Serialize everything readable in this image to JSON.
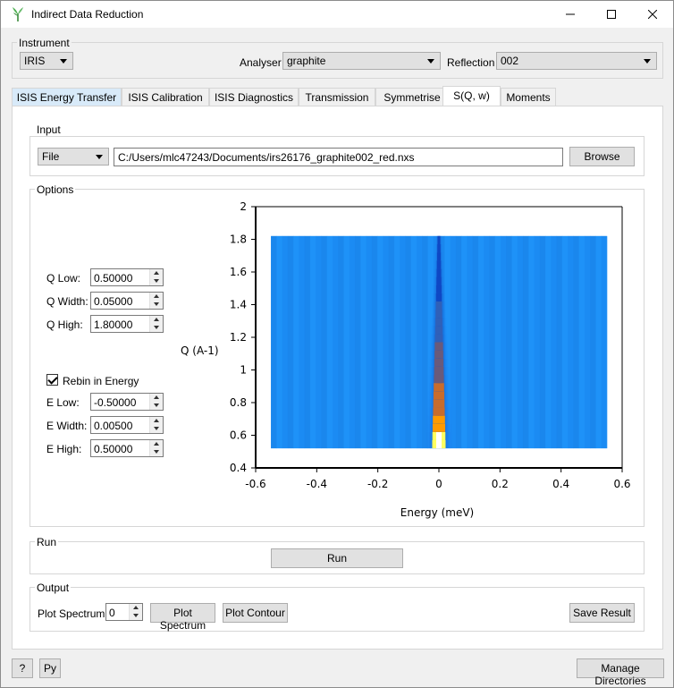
{
  "window": {
    "title": "Indirect Data Reduction",
    "controls": [
      "minimize-icon",
      "maximize-icon",
      "close-icon"
    ]
  },
  "instrument": {
    "group_title": "Instrument",
    "instrument_value": "IRIS",
    "analyser_label": "Analyser",
    "analyser_value": "graphite",
    "reflection_label": "Reflection",
    "reflection_value": "002"
  },
  "tabs": [
    {
      "label": "ISIS Energy Transfer"
    },
    {
      "label": "ISIS Calibration"
    },
    {
      "label": "ISIS Diagnostics"
    },
    {
      "label": "Transmission"
    },
    {
      "label": "Symmetrise"
    },
    {
      "label": "S(Q, w)"
    },
    {
      "label": "Moments"
    }
  ],
  "selected_tab": "S(Q, w)",
  "input": {
    "group_title": "Input",
    "source_type": "File",
    "file_path": "C:/Users/mlc47243/Documents/irs26176_graphite002_red.nxs",
    "browse_label": "Browse"
  },
  "options": {
    "group_title": "Options",
    "q_low_label": "Q Low:",
    "q_low_value": "0.50000",
    "q_width_label": "Q Width:",
    "q_width_value": "0.05000",
    "q_high_label": "Q High:",
    "q_high_value": "1.80000",
    "rebin_label": "Rebin in Energy",
    "rebin_checked": true,
    "e_low_label": "E Low:",
    "e_low_value": "-0.50000",
    "e_width_label": "E Width:",
    "e_width_value": "0.00500",
    "e_high_label": "E High:",
    "e_high_value": "0.50000"
  },
  "plot": {
    "xlabel": "Energy (meV)",
    "ylabel": "Q (A-1)",
    "x_ticks": [
      "-0.6",
      "-0.4",
      "-0.2",
      "0",
      "0.2",
      "0.4",
      "0.6"
    ],
    "y_ticks": [
      "0.4",
      "0.6",
      "0.8",
      "1",
      "1.2",
      "1.4",
      "1.6",
      "1.8",
      "2"
    ],
    "xlim": [
      -0.6,
      0.6
    ],
    "ylim": [
      0.4,
      2.0
    ],
    "colormap": "jet",
    "background_color": "#1c8cf4"
  },
  "chart_data": {
    "type": "heatmap",
    "xlabel": "Energy (meV)",
    "ylabel": "Q (A-1)",
    "xlim": [
      -0.6,
      0.6
    ],
    "ylim": [
      0.4,
      2.0
    ],
    "energy_range": [
      -0.55,
      0.55
    ],
    "q_range": [
      0.52,
      1.82
    ],
    "q_bin_width": 0.05,
    "peak_center_energy": 0.0,
    "colormap": "jet"
  },
  "run": {
    "group_title": "Run",
    "run_label": "Run"
  },
  "output": {
    "group_title": "Output",
    "plot_spectrum_label": "Plot Spectrum:",
    "plot_spectrum_value": "0",
    "plot_spectrum_button": "Plot Spectrum",
    "plot_contour_button": "Plot Contour",
    "save_result_button": "Save Result"
  },
  "footer": {
    "help_label": "?",
    "py_label": "Py",
    "manage_dirs_label": "Manage Directories"
  }
}
